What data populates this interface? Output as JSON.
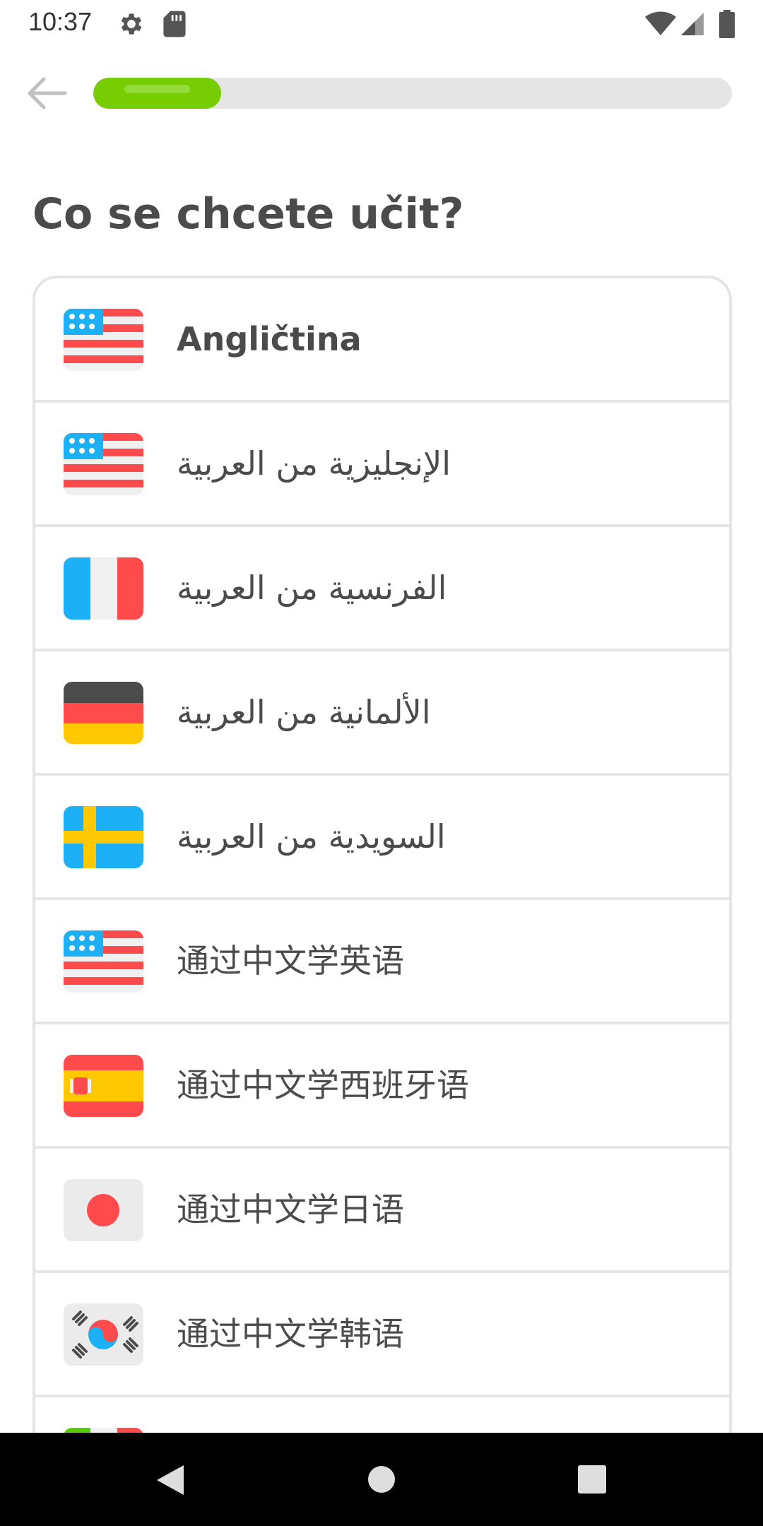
{
  "status_bar": {
    "time": "10:37",
    "icons": [
      "gear-icon",
      "sd-card-icon",
      "wifi-icon",
      "signal-icon",
      "battery-icon"
    ]
  },
  "header": {
    "back_icon": "arrow-left-icon",
    "progress_fraction": 0.2
  },
  "title": "Co se chcete učit?",
  "courses": [
    {
      "label": "Angličtina",
      "flag": "usa-flag-icon"
    },
    {
      "label": "الإنجليزية من العربية",
      "flag": "usa-flag-icon"
    },
    {
      "label": "الفرنسية من العربية",
      "flag": "france-flag-icon"
    },
    {
      "label": "الألمانية من العربية",
      "flag": "germany-flag-icon"
    },
    {
      "label": "السويدية من العربية",
      "flag": "sweden-flag-icon"
    },
    {
      "label": "通过中文学英语",
      "flag": "usa-flag-icon"
    },
    {
      "label": "通过中文学西班牙语",
      "flag": "spain-flag-icon"
    },
    {
      "label": "通过中文学日语",
      "flag": "japan-flag-icon"
    },
    {
      "label": "通过中文学韩语",
      "flag": "korea-flag-icon"
    }
  ],
  "colors": {
    "accent_green": "#77cc02",
    "border_gray": "#e5e5e5",
    "text": "#4b4b4b"
  },
  "nav_bar": {
    "icons": [
      "nav-back-icon",
      "nav-home-icon",
      "nav-recents-icon"
    ]
  }
}
